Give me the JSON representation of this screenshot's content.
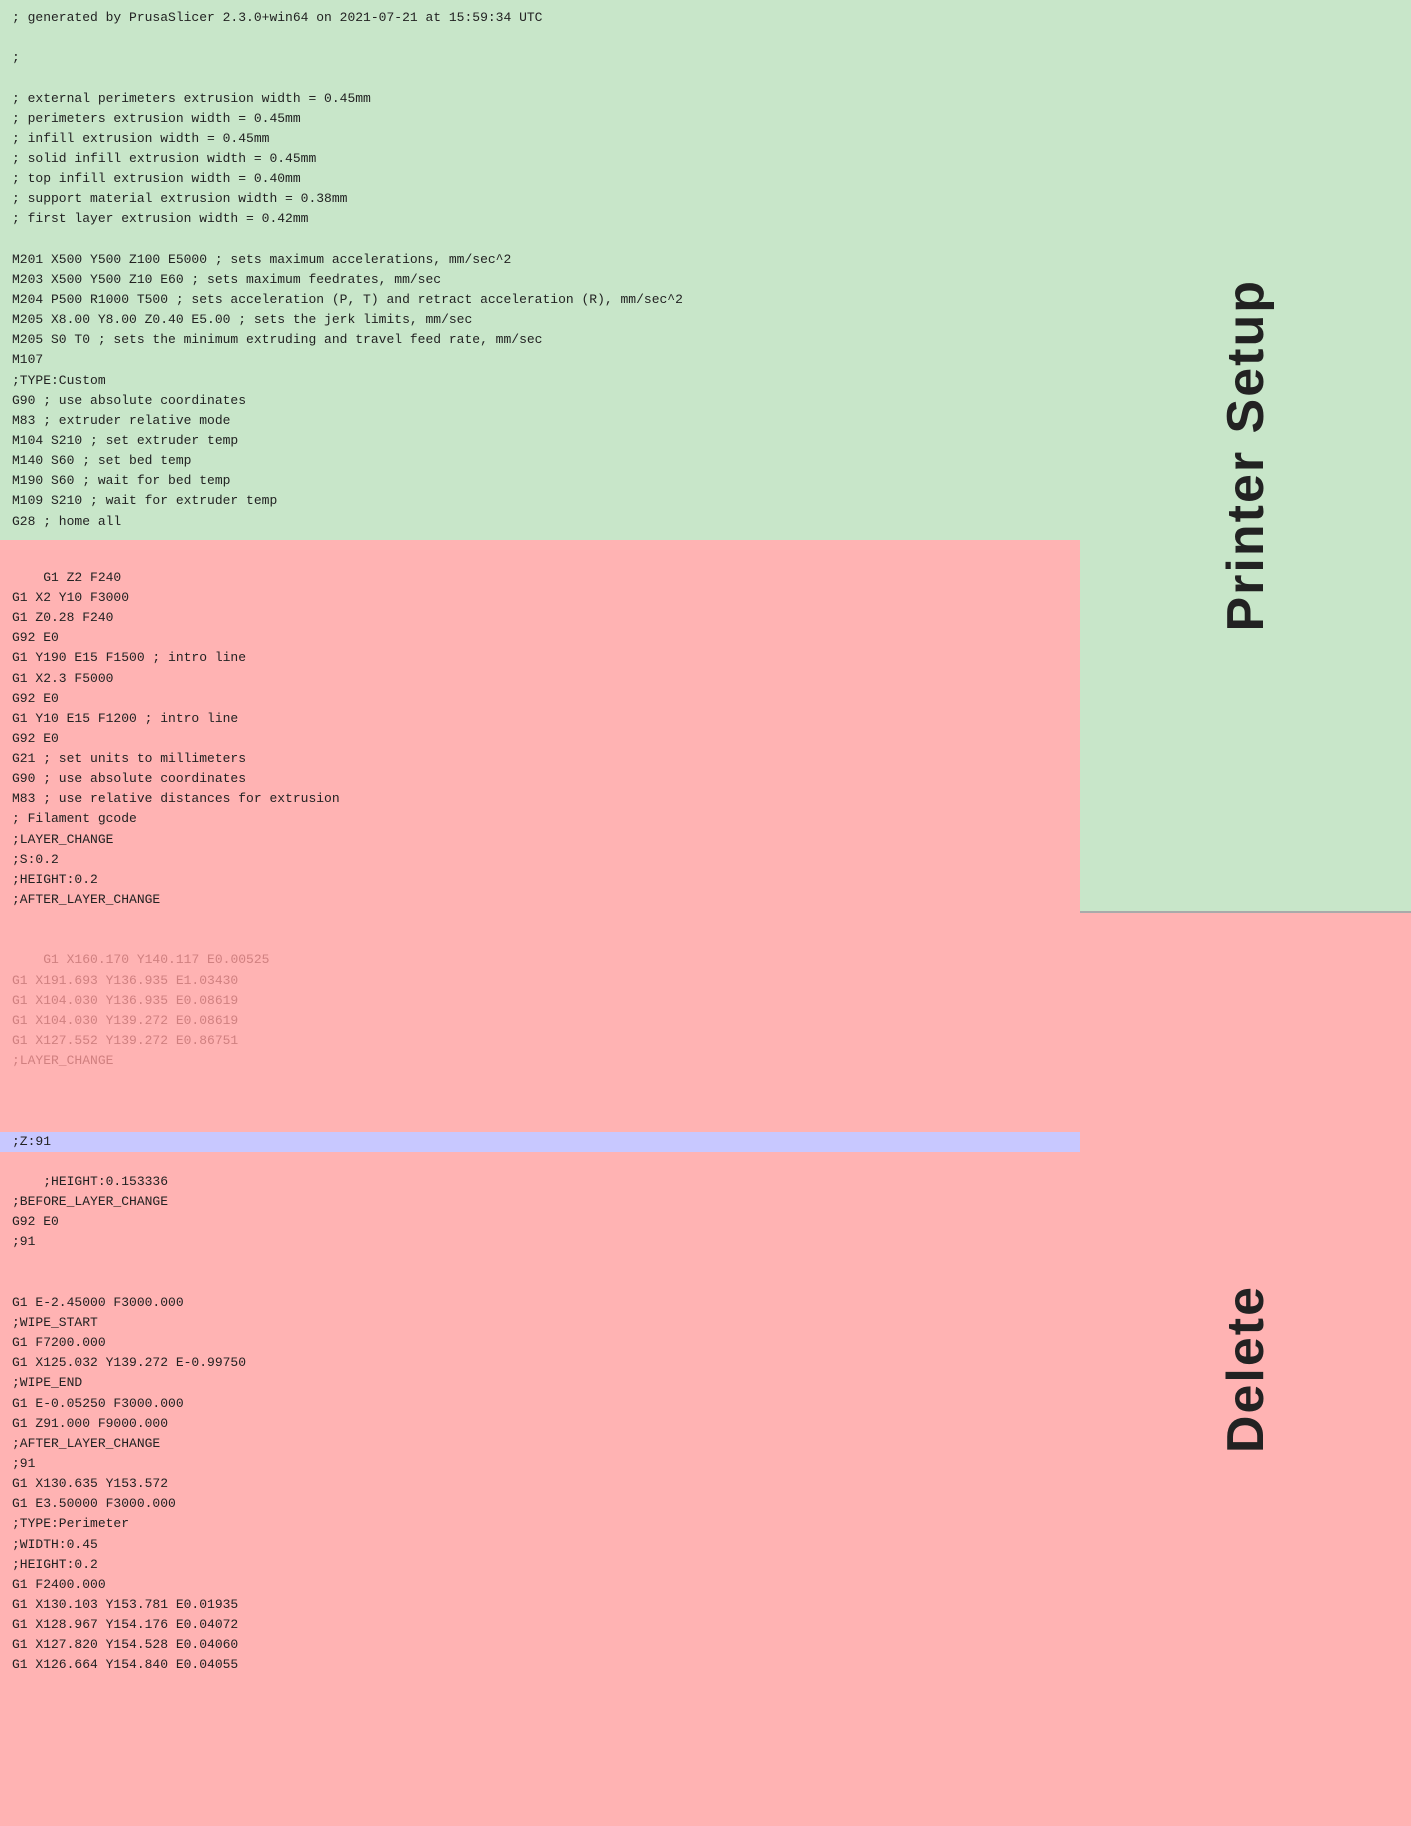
{
  "sidebar": {
    "printer_setup_label": "Printer Setup",
    "delete_label": "Delete"
  },
  "printer_setup_code": "; generated by PrusaSlicer 2.3.0+win64 on 2021-07-21 at 15:59:34 UTC\n\n;\n\n; external perimeters extrusion width = 0.45mm\n; perimeters extrusion width = 0.45mm\n; infill extrusion width = 0.45mm\n; solid infill extrusion width = 0.45mm\n; top infill extrusion width = 0.40mm\n; support material extrusion width = 0.38mm\n; first layer extrusion width = 0.42mm\n\nM201 X500 Y500 Z100 E5000 ; sets maximum accelerations, mm/sec^2\nM203 X500 Y500 Z10 E60 ; sets maximum feedrates, mm/sec\nM204 P500 R1000 T500 ; sets acceleration (P, T) and retract acceleration (R), mm/sec^2\nM205 X8.00 Y8.00 Z0.40 E5.00 ; sets the jerk limits, mm/sec\nM205 S0 T0 ; sets the minimum extruding and travel feed rate, mm/sec\nM107\n;TYPE:Custom\nG90 ; use absolute coordinates\nM83 ; extruder relative mode\nM104 S210 ; set extruder temp\nM140 S60 ; set bed temp\nM190 S60 ; wait for bed temp\nM109 S210 ; wait for extruder temp\nG28 ; home all",
  "delete_code_top": "G1 Z2 F240\nG1 X2 Y10 F3000\nG1 Z0.28 F240\nG92 E0\nG1 Y190 E15 F1500 ; intro line\nG1 X2.3 F5000\nG92 E0\nG1 Y10 E15 F1200 ; intro line\nG92 E0\nG21 ; set units to millimeters\nG90 ; use absolute coordinates\nM83 ; use relative distances for extrusion\n; Filament gcode\n;LAYER_CHANGE\n;S:0.2\n;HEIGHT:0.2\n;AFTER_LAYER_CHANGE",
  "delete_code_faded": "G1 X160.170 Y140.117 E0.00525\nG1 X191.693 Y136.935 E1.03430\nG1 X104.030 Y136.935 E0.08619\nG1 X104.030 Y139.272 E0.08619\nG1 X127.552 Y139.272 E0.86751\n;LAYER_CHANGE",
  "highlighted_line": ";Z:91",
  "delete_code_bottom": ";HEIGHT:0.153336\n;BEFORE_LAYER_CHANGE\nG92 E0\n;91\n\n\nG1 E-2.45000 F3000.000\n;WIPE_START\nG1 F7200.000\nG1 X125.032 Y139.272 E-0.99750\n;WIPE_END\nG1 E-0.05250 F3000.000\nG1 Z91.000 F9000.000\n;AFTER_LAYER_CHANGE\n;91\nG1 X130.635 Y153.572\nG1 E3.50000 F3000.000\n;TYPE:Perimeter\n;WIDTH:0.45\n;HEIGHT:0.2\nG1 F2400.000\nG1 X130.103 Y153.781 E0.01935\nG1 X128.967 Y154.176 E0.04072\nG1 X127.820 Y154.528 E0.04060\nG1 X126.664 Y154.840 E0.04055"
}
